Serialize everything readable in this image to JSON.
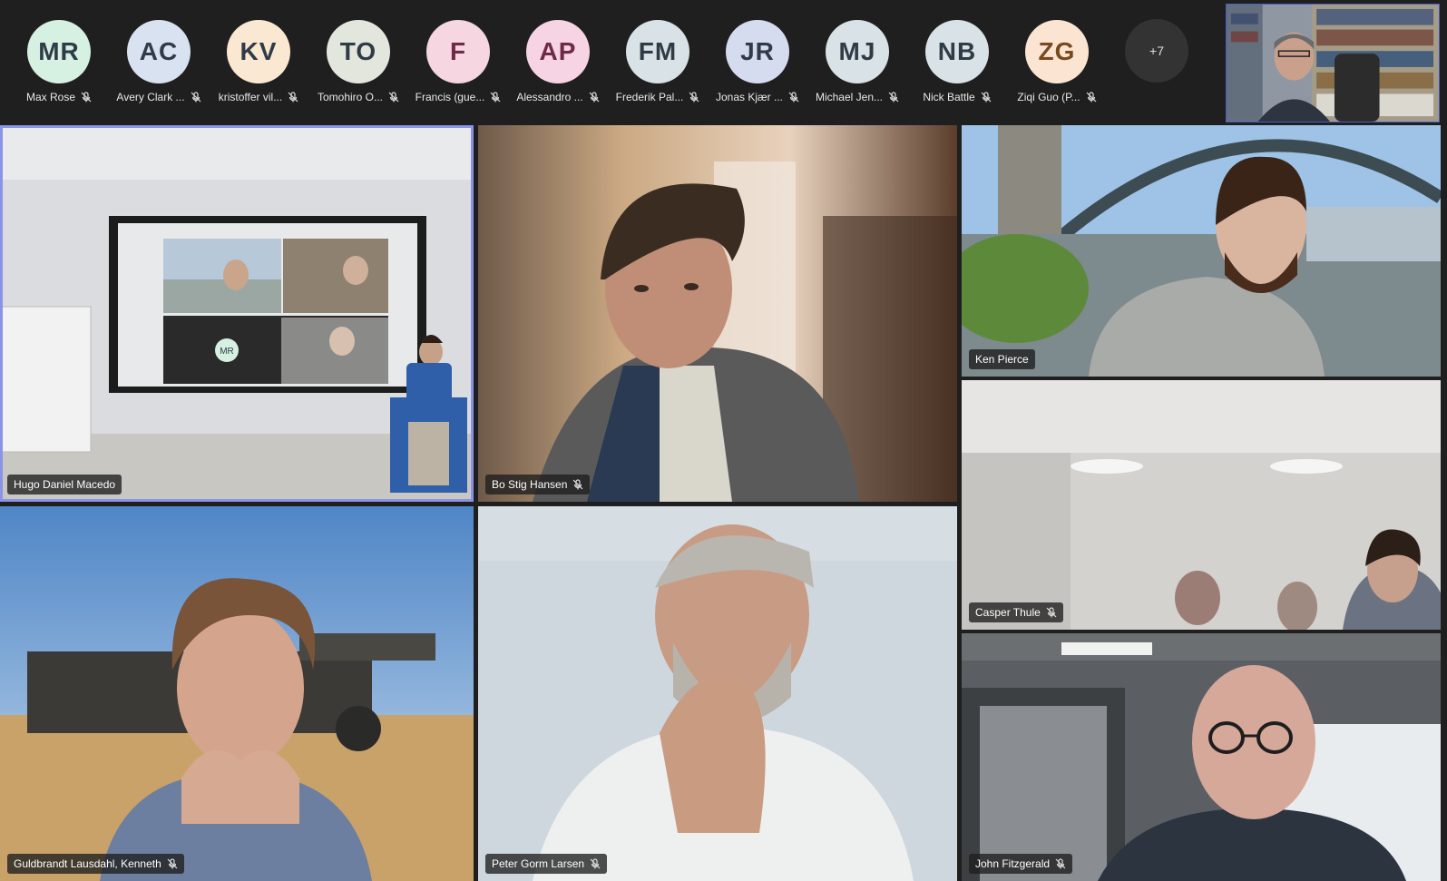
{
  "strip": {
    "participants": [
      {
        "initials": "MR",
        "name": "Max Rose",
        "bg": "#d6f0e2"
      },
      {
        "initials": "AC",
        "name": "Avery Clark ...",
        "bg": "#d8e2f0"
      },
      {
        "initials": "KV",
        "name": "kristoffer vil...",
        "bg": "#fbe8d2"
      },
      {
        "initials": "TO",
        "name": "Tomohiro O...",
        "bg": "#e3e6dd"
      },
      {
        "initials": "F",
        "name": "Francis (gue...",
        "bg": "#f5d6e1"
      },
      {
        "initials": "AP",
        "name": "Alessandro ...",
        "bg": "#f6d4e3"
      },
      {
        "initials": "FM",
        "name": "Frederik Pal...",
        "bg": "#d9e2e6"
      },
      {
        "initials": "JR",
        "name": "Jonas Kjær ...",
        "bg": "#d6dcef"
      },
      {
        "initials": "MJ",
        "name": "Michael Jen...",
        "bg": "#d9e2e6"
      },
      {
        "initials": "NB",
        "name": "Nick Battle",
        "bg": "#d9e2e6"
      },
      {
        "initials": "ZG",
        "name": "Ziqi Guo (P...",
        "bg": "#fbe5d2"
      }
    ],
    "overflow_label": "+7"
  },
  "tiles": {
    "hugo": "Hugo Daniel Macedo",
    "bo": "Bo Stig Hansen",
    "ken": "Ken Pierce",
    "casper": "Casper Thule",
    "guldbrandt": "Guldbrandt Lausdahl, Kenneth",
    "peter": "Peter Gorm Larsen",
    "john": "John Fitzgerald"
  },
  "room_screen": {
    "mini_avatar": "MR"
  },
  "colors": {
    "active_speaker": "#8b93e6",
    "background": "#1f1f1f"
  }
}
